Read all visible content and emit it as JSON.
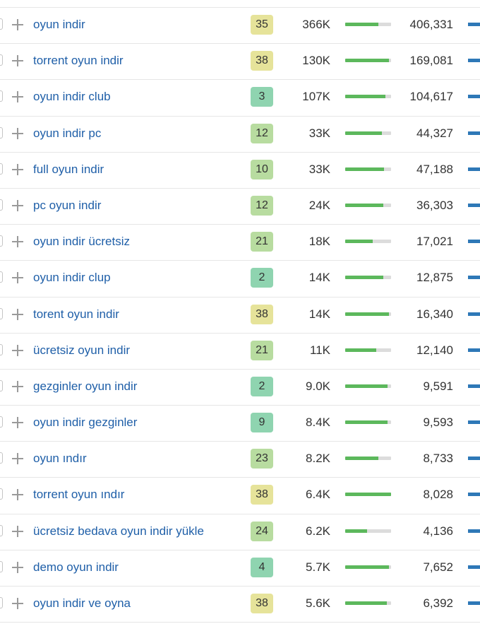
{
  "colors": {
    "link": "#1f5fa8",
    "bar_fill": "#5cb85c",
    "bar_track": "#dcdcdc",
    "edge_bar": "#2e78b7",
    "kd_easy": "#8fd4b0",
    "kd_medium": "#b8dca0",
    "kd_hard": "#e6e39a"
  },
  "rows": [
    {
      "keyword": "oyun indir",
      "kd": "35",
      "kd_level": "hard",
      "volume": "366K",
      "bar_pct": 72,
      "traffic": "406,331"
    },
    {
      "keyword": "torrent oyun indir",
      "kd": "38",
      "kd_level": "hard",
      "volume": "130K",
      "bar_pct": 95,
      "traffic": "169,081"
    },
    {
      "keyword": "oyun indir club",
      "kd": "3",
      "kd_level": "easy",
      "volume": "107K",
      "bar_pct": 88,
      "traffic": "104,617"
    },
    {
      "keyword": "oyun indir pc",
      "kd": "12",
      "kd_level": "medium",
      "volume": "33K",
      "bar_pct": 80,
      "traffic": "44,327"
    },
    {
      "keyword": "full oyun indir",
      "kd": "10",
      "kd_level": "medium",
      "volume": "33K",
      "bar_pct": 85,
      "traffic": "47,188"
    },
    {
      "keyword": "pc oyun indir",
      "kd": "12",
      "kd_level": "medium",
      "volume": "24K",
      "bar_pct": 83,
      "traffic": "36,303"
    },
    {
      "keyword": "oyun indir ücretsiz",
      "kd": "21",
      "kd_level": "medium",
      "volume": "18K",
      "bar_pct": 60,
      "traffic": "17,021"
    },
    {
      "keyword": "oyun indir clup",
      "kd": "2",
      "kd_level": "easy",
      "volume": "14K",
      "bar_pct": 83,
      "traffic": "12,875"
    },
    {
      "keyword": "torent oyun indir",
      "kd": "38",
      "kd_level": "hard",
      "volume": "14K",
      "bar_pct": 95,
      "traffic": "16,340"
    },
    {
      "keyword": "ücretsiz oyun indir",
      "kd": "21",
      "kd_level": "medium",
      "volume": "11K",
      "bar_pct": 68,
      "traffic": "12,140"
    },
    {
      "keyword": "gezginler oyun indir",
      "kd": "2",
      "kd_level": "easy",
      "volume": "9.0K",
      "bar_pct": 92,
      "traffic": "9,591"
    },
    {
      "keyword": "oyun indir gezginler",
      "kd": "9",
      "kd_level": "easy",
      "volume": "8.4K",
      "bar_pct": 92,
      "traffic": "9,593"
    },
    {
      "keyword": "oyun ındır",
      "kd": "23",
      "kd_level": "medium",
      "volume": "8.2K",
      "bar_pct": 72,
      "traffic": "8,733"
    },
    {
      "keyword": "torrent oyun ındır",
      "kd": "38",
      "kd_level": "hard",
      "volume": "6.4K",
      "bar_pct": 100,
      "traffic": "8,028"
    },
    {
      "keyword": "ücretsiz bedava oyun indir yükle",
      "kd": "24",
      "kd_level": "medium",
      "volume": "6.2K",
      "bar_pct": 47,
      "traffic": "4,136"
    },
    {
      "keyword": "demo oyun indir",
      "kd": "4",
      "kd_level": "easy",
      "volume": "5.7K",
      "bar_pct": 95,
      "traffic": "7,652"
    },
    {
      "keyword": "oyun indir ve oyna",
      "kd": "38",
      "kd_level": "hard",
      "volume": "5.6K",
      "bar_pct": 90,
      "traffic": "6,392"
    }
  ]
}
